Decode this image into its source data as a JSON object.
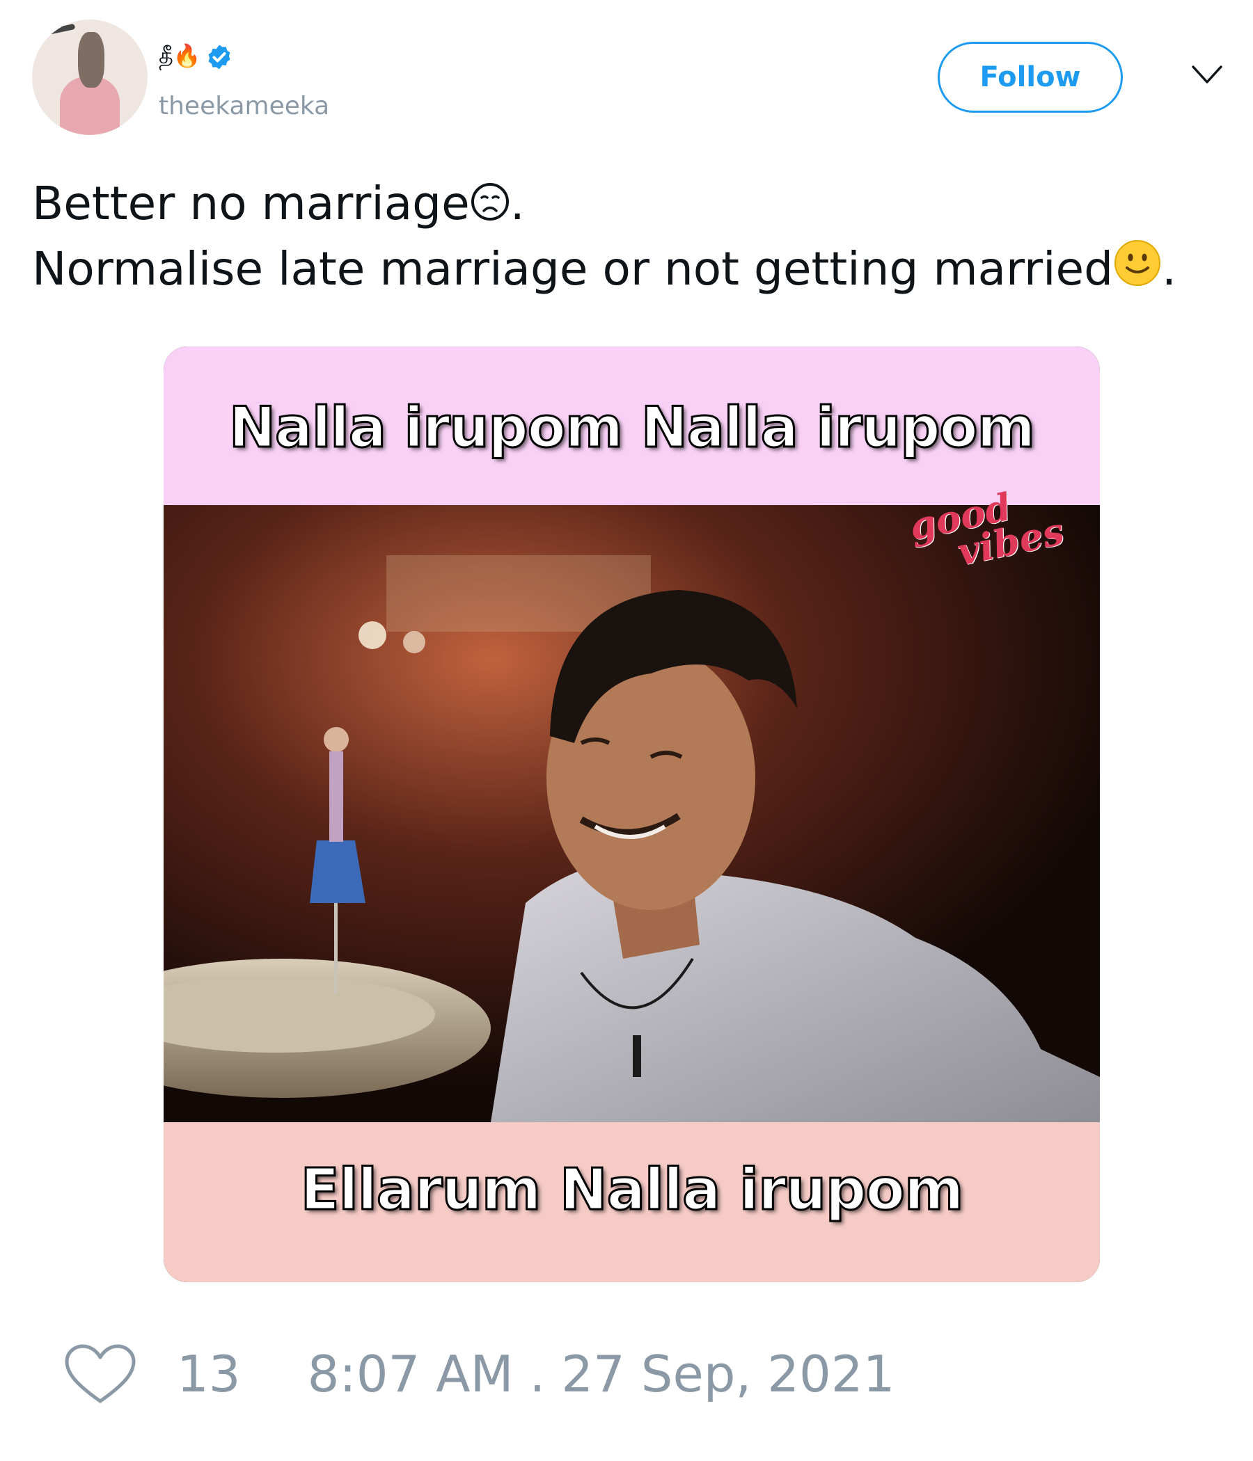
{
  "tweet": {
    "display_name": "தீ🔥",
    "handle": "theekameeka",
    "verified": true,
    "follow_label": "Follow",
    "text_line1": "Better no marriage",
    "text_line1_end": ".",
    "text_line2": "Normalise late marriage or not getting married",
    "text_line2_end": ".",
    "media": {
      "caption_top": "Nalla irupom Nalla irupom",
      "caption_bottom": "Ellarum Nalla irupom",
      "watermark_line1": "good",
      "watermark_line2": "vibes"
    },
    "likes": "13",
    "timestamp": "8:07 AM . 27 Sep, 2021"
  },
  "icons": {
    "verified": "verified-badge-icon",
    "caret": "chevron-down-icon",
    "like": "heart-icon",
    "emoji_1": "disappointed-face-emoji",
    "emoji_2": "slightly-smiling-face-emoji"
  },
  "colors": {
    "accent": "#1d9bf0",
    "muted": "#8b98a5",
    "text": "#0f1419",
    "watermark": "#e0395a",
    "caption_band_top": "#f9d1f6",
    "caption_band_bottom": "#f6cbc6"
  }
}
